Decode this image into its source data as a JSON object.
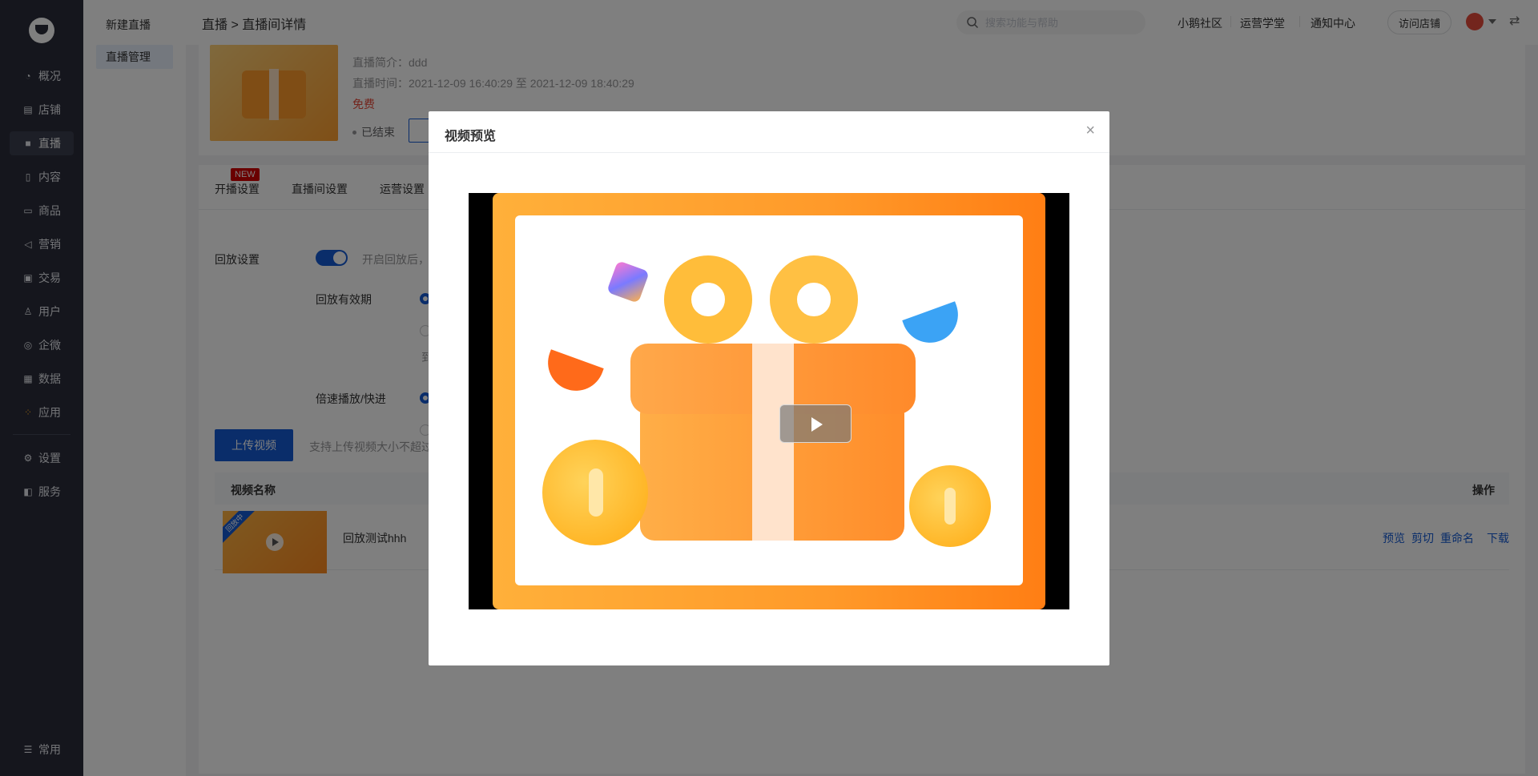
{
  "nav": {
    "items": [
      {
        "label": "概况",
        "icon": "pie-chart-icon"
      },
      {
        "label": "店铺",
        "icon": "store-icon"
      },
      {
        "label": "直播",
        "icon": "live-video-icon"
      },
      {
        "label": "内容",
        "icon": "document-icon"
      },
      {
        "label": "商品",
        "icon": "goods-icon"
      },
      {
        "label": "营销",
        "icon": "megaphone-icon"
      },
      {
        "label": "交易",
        "icon": "transaction-icon"
      },
      {
        "label": "用户",
        "icon": "user-icon"
      },
      {
        "label": "企微",
        "icon": "wecom-icon"
      },
      {
        "label": "数据",
        "icon": "data-icon"
      },
      {
        "label": "应用",
        "icon": "apps-icon"
      },
      {
        "label": "设置",
        "icon": "gear-icon"
      },
      {
        "label": "服务",
        "icon": "service-icon"
      }
    ],
    "bottom": {
      "label": "常用",
      "icon": "menu-list-icon"
    }
  },
  "subnav": {
    "items": [
      "新建直播",
      "直播管理"
    ]
  },
  "header": {
    "breadcrumb": "直播 > 直播间详情",
    "search_placeholder": "搜索功能与帮助",
    "links": [
      "小鹅社区",
      "运营学堂",
      "通知中心"
    ],
    "visit_store": "访问店铺"
  },
  "live": {
    "intro": "直播简介：ddd",
    "time": "直播时间：2021-12-09 16:40:29 至 2021-12-09 18:40:29",
    "price": "免费",
    "status": "已结束"
  },
  "tabs": {
    "items": [
      "开播设置",
      "直播间设置",
      "运营设置"
    ],
    "new_badge": "NEW"
  },
  "replay": {
    "label": "回放设置",
    "hint": "开启回放后，",
    "validity_label": "回放有效期",
    "speed_label": "倍速播放/快进",
    "truncated_text": "到",
    "upload_button": "上传视频",
    "upload_hint": "支持上传视频大小不超过"
  },
  "table": {
    "col_name": "视频名称",
    "col_ops": "操作",
    "rows": [
      {
        "name": "回放测试hhh",
        "thumb_tag": "回放中",
        "ops": [
          "预览",
          "剪切",
          "重命名",
          "下载"
        ]
      }
    ]
  },
  "modal": {
    "title": "视频预览",
    "close": "×"
  },
  "colors": {
    "primary": "#155bd4",
    "danger": "#e64a3b",
    "nav_bg": "#2a2d3a"
  }
}
